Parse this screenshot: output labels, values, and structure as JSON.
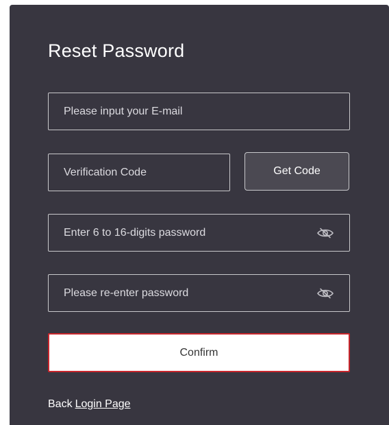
{
  "form": {
    "title": "Reset Password",
    "email": {
      "placeholder": "Please input your E-mail",
      "value": ""
    },
    "code": {
      "placeholder": "Verification Code",
      "value": ""
    },
    "get_code_label": "Get Code",
    "password": {
      "placeholder": "Enter 6 to 16-digits password",
      "value": ""
    },
    "confirm_password": {
      "placeholder": "Please re-enter password",
      "value": ""
    },
    "confirm_label": "Confirm",
    "back_text": "Back",
    "login_link": "Login Page"
  },
  "icons": {
    "password_toggle": "eye-slash-icon",
    "confirm_password_toggle": "eye-slash-icon"
  },
  "colors": {
    "panel_background": "#383640",
    "confirm_border": "#c8262c",
    "get_code_background": "#4b4952",
    "input_border": "#c9c9cc"
  }
}
